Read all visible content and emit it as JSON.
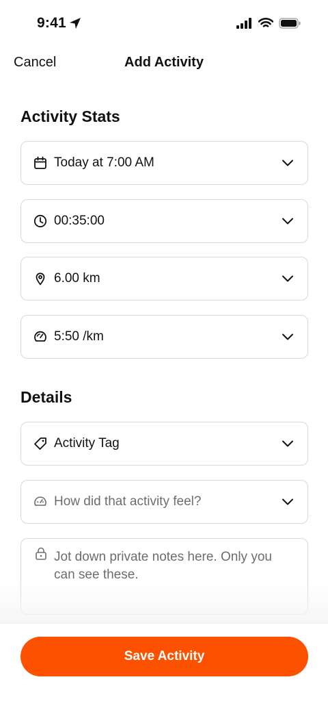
{
  "status_bar": {
    "time": "9:41"
  },
  "nav": {
    "cancel_label": "Cancel",
    "title": "Add Activity"
  },
  "sections": {
    "stats_title": "Activity Stats",
    "details_title": "Details"
  },
  "stats_fields": {
    "date": {
      "value": "Today at 7:00 AM",
      "icon": "calendar-icon"
    },
    "duration": {
      "value": "00:35:00",
      "icon": "clock-icon"
    },
    "distance": {
      "value": "6.00 km",
      "icon": "location-pin-icon"
    },
    "pace": {
      "value": "5:50 /km",
      "icon": "speedometer-icon"
    }
  },
  "details_fields": {
    "tag": {
      "value": "Activity Tag",
      "icon": "tag-icon"
    },
    "feel": {
      "placeholder": "How did that activity feel?",
      "icon": "gauge-icon"
    },
    "notes": {
      "placeholder": "Jot down private notes here. Only you can see these.",
      "icon": "lock-icon"
    }
  },
  "footer": {
    "save_label": "Save Activity"
  },
  "colors": {
    "accent": "#fc5200",
    "border": "#d9d9d9",
    "placeholder": "#6d6d6d"
  }
}
